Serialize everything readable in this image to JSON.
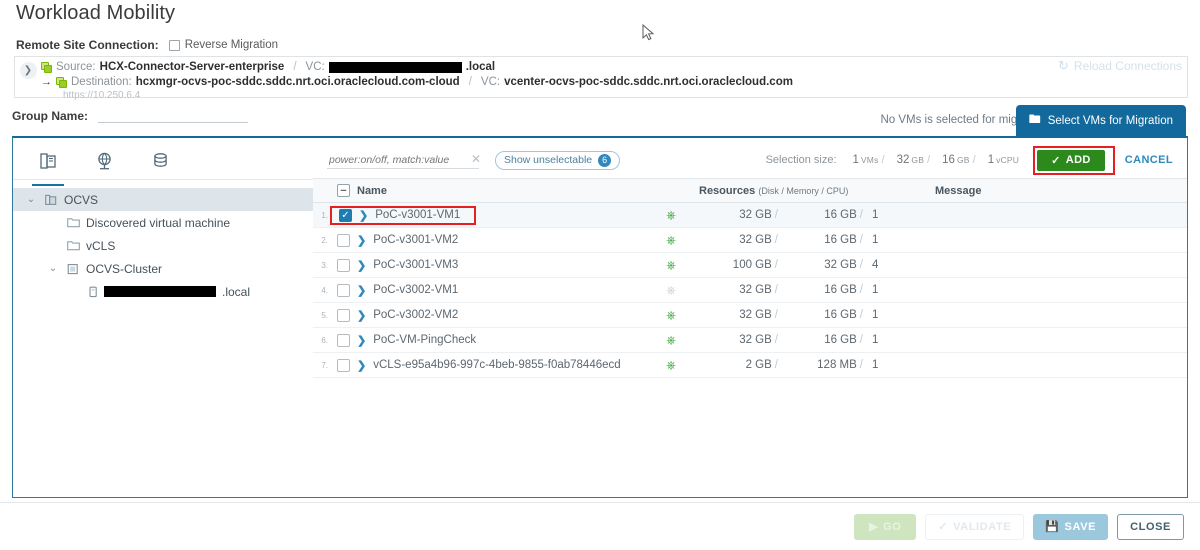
{
  "page": {
    "title": "Workload Mobility"
  },
  "remote_site": {
    "label": "Remote Site Connection:",
    "reverse_migration_label": "Reverse Migration",
    "reverse_migration_checked": false
  },
  "connection": {
    "source_label": "Source:",
    "source_value": "HCX-Connector-Server-enterprise",
    "source_vc_label": "VC:",
    "source_vc_value": ".local",
    "source_vc_redacted": true,
    "destination_label": "Destination:",
    "destination_value": "hcxmgr-ocvs-poc-sddc.sddc.nrt.oci.oraclecloud.com-cloud",
    "destination_vc_label": "VC:",
    "destination_vc_value": "vcenter-ocvs-poc-sddc.sddc.nrt.oci.oraclecloud.com",
    "url": "https://10.250.6.4",
    "reload_label": "Reload Connections"
  },
  "group": {
    "label": "Group Name:",
    "value": "",
    "placeholder": ""
  },
  "selection_status": {
    "text": "No VMs is selected for migration"
  },
  "select_tab": {
    "label": "Select VMs for Migration"
  },
  "tree": {
    "tabs": [
      {
        "name": "virtual-machines",
        "active": true
      },
      {
        "name": "networks",
        "active": false
      },
      {
        "name": "datastores",
        "active": false
      }
    ],
    "nodes": [
      {
        "label": "OCVS",
        "indent": 0,
        "expander": "⌄",
        "icon": "datacenter",
        "selected": true
      },
      {
        "label": "Discovered virtual machine",
        "indent": 1,
        "expander": "",
        "icon": "folder",
        "selected": false
      },
      {
        "label": "vCLS",
        "indent": 1,
        "expander": "",
        "icon": "folder",
        "selected": false
      },
      {
        "label": "OCVS-Cluster",
        "indent": 1,
        "expander": "⌄",
        "icon": "cluster",
        "selected": false
      },
      {
        "label": ".local",
        "indent": 2,
        "expander": "",
        "icon": "host",
        "selected": false,
        "redacted": true
      }
    ]
  },
  "grid_toolbar": {
    "filter_placeholder": "power:on/off, match:value",
    "filter_value": "",
    "clear_icon": "✕",
    "show_unselectable_label": "Show unselectable",
    "show_unselectable_count": "6",
    "selection_size_label": "Selection size:",
    "selection_vms": "1",
    "selection_vms_unit": "VMs",
    "selection_disk": "32",
    "selection_disk_unit": "GB",
    "selection_memory": "16",
    "selection_memory_unit": "GB",
    "selection_cpu": "1",
    "selection_cpu_unit": "vCPU",
    "add_label": "ADD",
    "cancel_label": "CANCEL"
  },
  "grid": {
    "col_name": "Name",
    "col_resources": "Resources",
    "col_resources_sub": "(Disk / Memory / CPU)",
    "col_message": "Message",
    "rows": [
      {
        "idx": "1.",
        "name": "PoC-v3001-VM1",
        "checked": true,
        "power": "on",
        "disk": "32 GB",
        "memory": "16 GB",
        "cpu": "1",
        "message": "",
        "highlight": true
      },
      {
        "idx": "2.",
        "name": "PoC-v3001-VM2",
        "checked": false,
        "power": "on",
        "disk": "32 GB",
        "memory": "16 GB",
        "cpu": "1",
        "message": "",
        "highlight": false
      },
      {
        "idx": "3.",
        "name": "PoC-v3001-VM3",
        "checked": false,
        "power": "on",
        "disk": "100 GB",
        "memory": "32 GB",
        "cpu": "4",
        "message": "",
        "highlight": false
      },
      {
        "idx": "4.",
        "name": "PoC-v3002-VM1",
        "checked": false,
        "power": "off",
        "disk": "32 GB",
        "memory": "16 GB",
        "cpu": "1",
        "message": "",
        "highlight": false
      },
      {
        "idx": "5.",
        "name": "PoC-v3002-VM2",
        "checked": false,
        "power": "on",
        "disk": "32 GB",
        "memory": "16 GB",
        "cpu": "1",
        "message": "",
        "highlight": false
      },
      {
        "idx": "6.",
        "name": "PoC-VM-PingCheck",
        "checked": false,
        "power": "on",
        "disk": "32 GB",
        "memory": "16 GB",
        "cpu": "1",
        "message": "",
        "highlight": false
      },
      {
        "idx": "7.",
        "name": "vCLS-e95a4b96-997c-4beb-9855-f0ab78446ecd",
        "checked": false,
        "power": "on",
        "disk": "2 GB",
        "memory": "128 MB",
        "cpu": "1",
        "message": "",
        "highlight": false
      }
    ]
  },
  "footer": {
    "go_label": "GO",
    "validate_label": "VALIDATE",
    "save_label": "SAVE",
    "close_label": "CLOSE"
  },
  "colors": {
    "tab_blue": "#13699b",
    "link_blue": "#2f89bd",
    "add_green": "#2c8a1c",
    "annotation_red": "#e62020",
    "power_on_green": "#2f9e2f",
    "power_off_grey": "#c9ced2"
  }
}
